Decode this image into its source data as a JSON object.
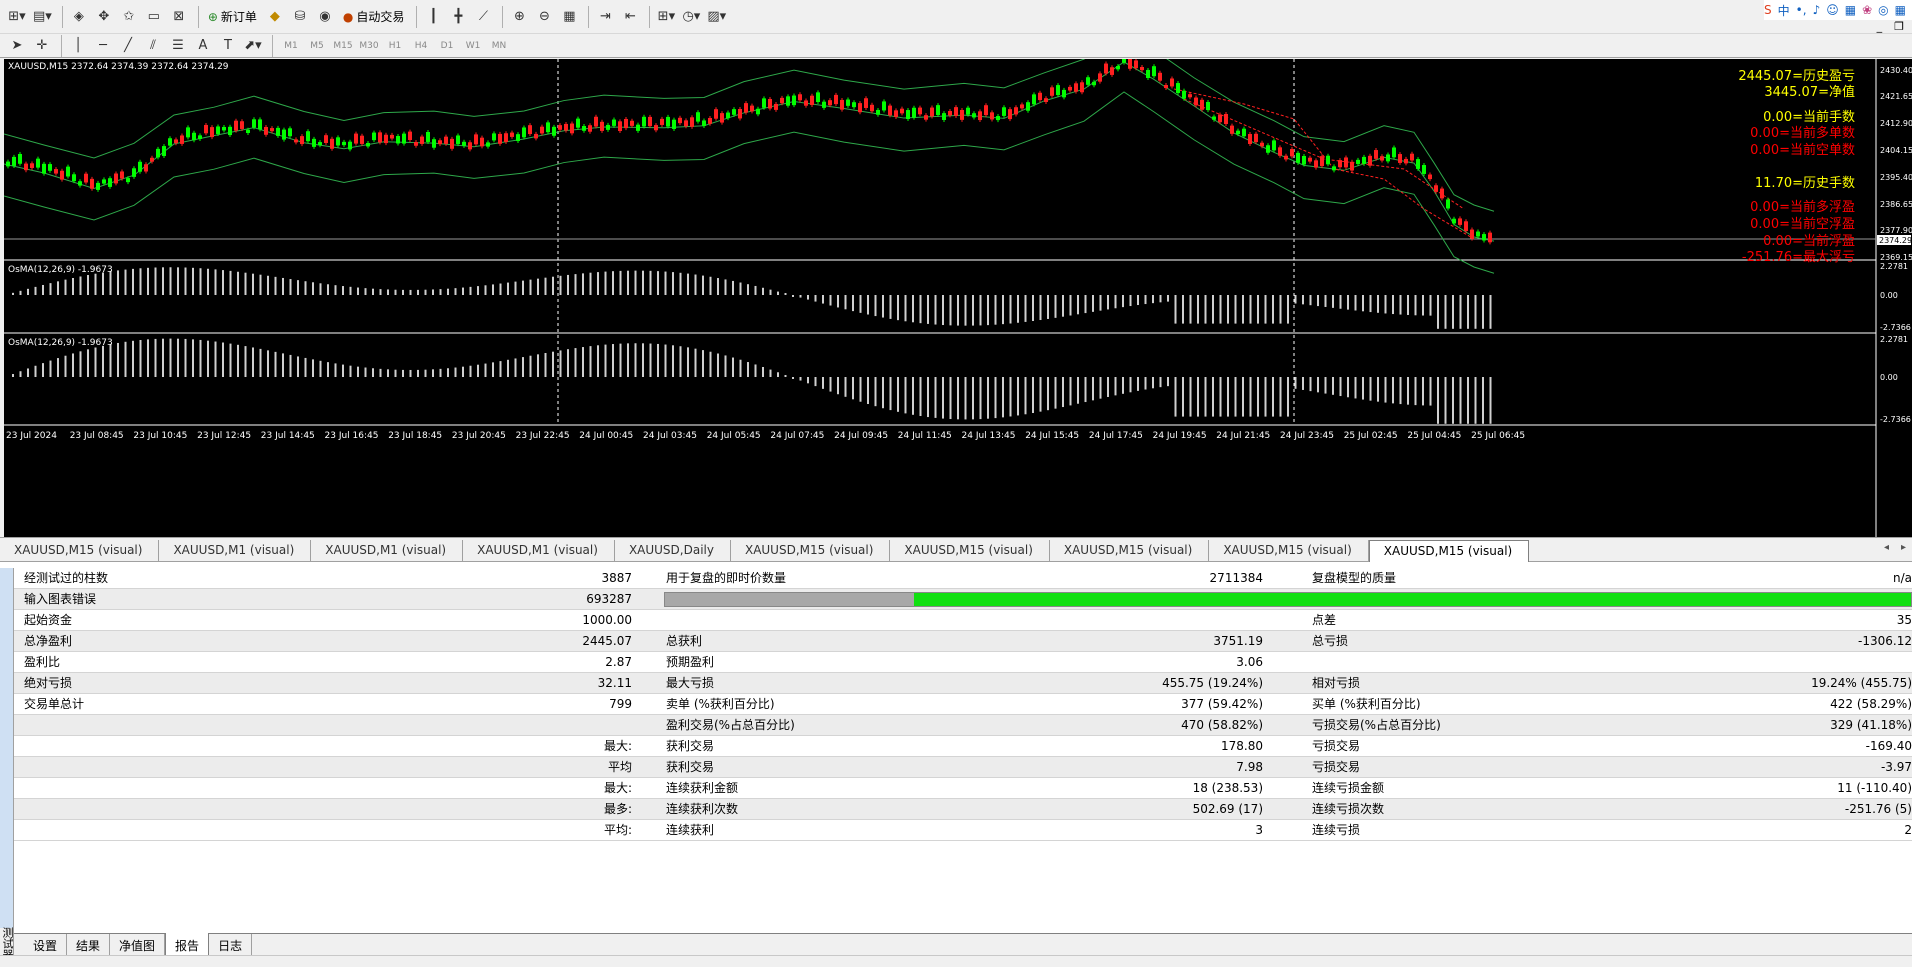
{
  "toolbar": {
    "new_order_label": "新订单",
    "auto_trade_label": "自动交易",
    "timeframes": [
      "M1",
      "M5",
      "M15",
      "M30",
      "H1",
      "H4",
      "D1",
      "W1",
      "MN"
    ]
  },
  "system_tray": {
    "lang": "中"
  },
  "chart": {
    "symbol_info": "XAUUSD,M15  2372.64 2374.39 2372.64 2374.29",
    "price_labels": [
      "2430.40",
      "2421.65",
      "2412.90",
      "2404.15",
      "2395.40",
      "2386.65",
      "2377.90",
      "2369.15"
    ],
    "current_price": "2374.29",
    "info_lines": [
      {
        "text": "2445.07=历史盈亏",
        "color": "#ffff00"
      },
      {
        "text": "3445.07=净值",
        "color": "#ffff00"
      },
      {
        "text": "0.00=当前手数",
        "color": "#ffff00"
      },
      {
        "text": "0.00=当前多单数",
        "color": "#ff0000"
      },
      {
        "text": "0.00=当前空单数",
        "color": "#ff0000"
      },
      {
        "text": "11.70=历史手数",
        "color": "#ffff00"
      },
      {
        "text": "0.00=当前多浮盈",
        "color": "#ff0000"
      },
      {
        "text": "0.00=当前空浮盈",
        "color": "#ff0000"
      },
      {
        "text": "0.00=当前浮盈",
        "color": "#ff0000"
      },
      {
        "text": "-251.76=最大浮亏",
        "color": "#ff0000"
      }
    ],
    "osma1": {
      "label": "OsMA(12,26,9) -1.9673",
      "ticks": [
        "2.2781",
        "0.00",
        "-2.7366"
      ]
    },
    "osma2": {
      "label": "OsMA(12,26,9) -1.9673",
      "ticks": [
        "2.2781",
        "0.00",
        "-2.7366"
      ]
    },
    "time_labels": [
      "23 Jul 2024",
      "23 Jul 08:45",
      "23 Jul 10:45",
      "23 Jul 12:45",
      "23 Jul 14:45",
      "23 Jul 16:45",
      "23 Jul 18:45",
      "23 Jul 20:45",
      "23 Jul 22:45",
      "24 Jul 00:45",
      "24 Jul 03:45",
      "24 Jul 05:45",
      "24 Jul 07:45",
      "24 Jul 09:45",
      "24 Jul 11:45",
      "24 Jul 13:45",
      "24 Jul 15:45",
      "24 Jul 17:45",
      "24 Jul 19:45",
      "24 Jul 21:45",
      "24 Jul 23:45",
      "25 Jul 02:45",
      "25 Jul 04:45",
      "25 Jul 06:45"
    ]
  },
  "chart_tabs": [
    "XAUUSD,M15 (visual)",
    "XAUUSD,M1 (visual)",
    "XAUUSD,M1 (visual)",
    "XAUUSD,M1 (visual)",
    "XAUUSD,Daily",
    "XAUUSD,M15 (visual)",
    "XAUUSD,M15 (visual)",
    "XAUUSD,M15 (visual)",
    "XAUUSD,M15 (visual)",
    "XAUUSD,M15 (visual)"
  ],
  "report": {
    "rows": [
      {
        "l1": "经测试过的柱数",
        "v1": "3887",
        "l2": "用于复盘的即时价数量",
        "v2": "2711384",
        "l3": "复盘模型的质量",
        "v3": "n/a"
      },
      {
        "l1": "输入图表错误",
        "v1": "693287",
        "progress": true
      },
      {
        "l1": "起始资金",
        "v1": "1000.00",
        "l2": "",
        "v2": "",
        "l3": "点差",
        "v3": "35"
      },
      {
        "l1": "总净盈利",
        "v1": "2445.07",
        "l2": "总获利",
        "v2": "3751.19",
        "l3": "总亏损",
        "v3": "-1306.12"
      },
      {
        "l1": "盈利比",
        "v1": "2.87",
        "l2": "预期盈利",
        "v2": "3.06",
        "l3": "",
        "v3": ""
      },
      {
        "l1": "绝对亏损",
        "v1": "32.11",
        "l2": "最大亏损",
        "v2": "455.75 (19.24%)",
        "l3": "相对亏损",
        "v3": "19.24% (455.75)"
      },
      {
        "l1": "交易单总计",
        "v1": "799",
        "l2": "卖单 (%获利百分比)",
        "v2": "377 (59.42%)",
        "l3": "买单 (%获利百分比)",
        "v3": "422 (58.29%)"
      },
      {
        "l1": "",
        "v1": "",
        "l2": "盈利交易(%占总百分比)",
        "v2": "470 (58.82%)",
        "l3": "亏损交易(%占总百分比)",
        "v3": "329 (41.18%)"
      },
      {
        "l1": "",
        "v1": "最大:",
        "l2": "获利交易",
        "v2": "178.80",
        "l3": "亏损交易",
        "v3": "-169.40"
      },
      {
        "l1": "",
        "v1": "平均",
        "l2": "获利交易",
        "v2": "7.98",
        "l3": "亏损交易",
        "v3": "-3.97"
      },
      {
        "l1": "",
        "v1": "最大:",
        "l2": "连续获利金额",
        "v2": "18 (238.53)",
        "l3": "连续亏损金额",
        "v3": "11 (-110.40)"
      },
      {
        "l1": "",
        "v1": "最多:",
        "l2": "连续获利次数",
        "v2": "502.69 (17)",
        "l3": "连续亏损次数",
        "v3": "-251.76 (5)"
      },
      {
        "l1": "",
        "v1": "平均:",
        "l2": "连续获利",
        "v2": "3",
        "l3": "连续亏损",
        "v3": "2"
      }
    ],
    "modeling_quality": {
      "gray_fraction": 0.2,
      "green_fraction": 0.8
    }
  },
  "bottom_tabs": [
    "设置",
    "结果",
    "净值图",
    "报告",
    "日志"
  ],
  "sidebar_label": "测试器"
}
